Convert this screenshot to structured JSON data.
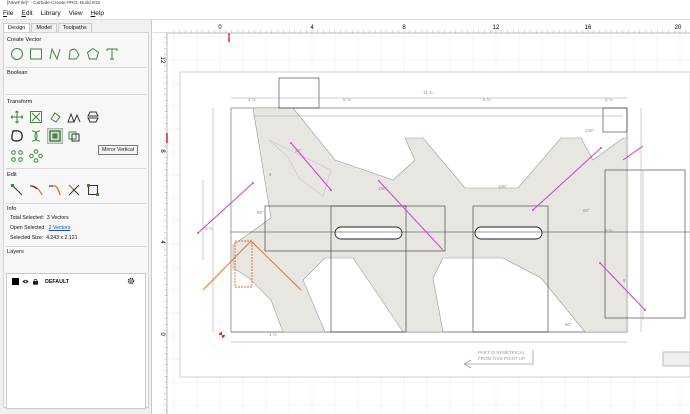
{
  "app": {
    "title": "[NewFile]* - Carbide Create PRO, Build 815"
  },
  "menu": [
    {
      "pre": "",
      "u": "F",
      "post": "ile"
    },
    {
      "pre": "",
      "u": "E",
      "post": "dit"
    },
    {
      "pre": "",
      "u": "",
      "post": "Library"
    },
    {
      "pre": "",
      "u": "",
      "post": "View"
    },
    {
      "pre": "",
      "u": "H",
      "post": "elp"
    }
  ],
  "tabs": [
    "Design",
    "Model",
    "Toolpaths"
  ],
  "sections": {
    "create_vector": "Create Vector",
    "boolean": "Boolean",
    "transform": "Transform",
    "edit": "Edit",
    "info": "Info",
    "layers": "Layers"
  },
  "create_icons": [
    "circle-icon",
    "rectangle-icon",
    "curve-icon",
    "polyline-icon",
    "polygon-icon",
    "text-icon"
  ],
  "transform_icons": [
    "move-icon",
    "scale-icon",
    "rotate-icon",
    "align-icon",
    "mirror-horizontal-icon",
    "mirror-vertical-icon",
    "offset-icon",
    "join-icon",
    "group-icon",
    "ungroup-icon",
    "array-icon",
    "circular-array-icon"
  ],
  "edit_icons": [
    "node-edit-icon",
    "trim-icon",
    "fillet-icon",
    "cut-icon",
    "bounding-box-icon"
  ],
  "tooltip": "Mirror Vertical",
  "info": {
    "total_label": "Total Selected:",
    "total_value": "3 Vectors",
    "open_label": "Open Selected:",
    "open_value": "2 Vectors",
    "size_label": "Selected Size:",
    "size_value": "4.243 x 2.121"
  },
  "layer": {
    "name": "DEFAULT"
  },
  "ruler": {
    "top_ticks": [
      "0",
      "4",
      "8",
      "12",
      "16",
      "20"
    ],
    "left_ticks": [
      "12",
      "8",
      "4",
      "0"
    ]
  },
  "drawing_note": [
    "PART IS SYMETRICAL",
    "FROM THIS POINT UP"
  ],
  "colors": {
    "selection": "#d13fd1",
    "origin": "#e02020",
    "accent_orange": "#e0701c",
    "shape_fill": "#e8e6e1",
    "green_icon": "#3a8a3a"
  }
}
